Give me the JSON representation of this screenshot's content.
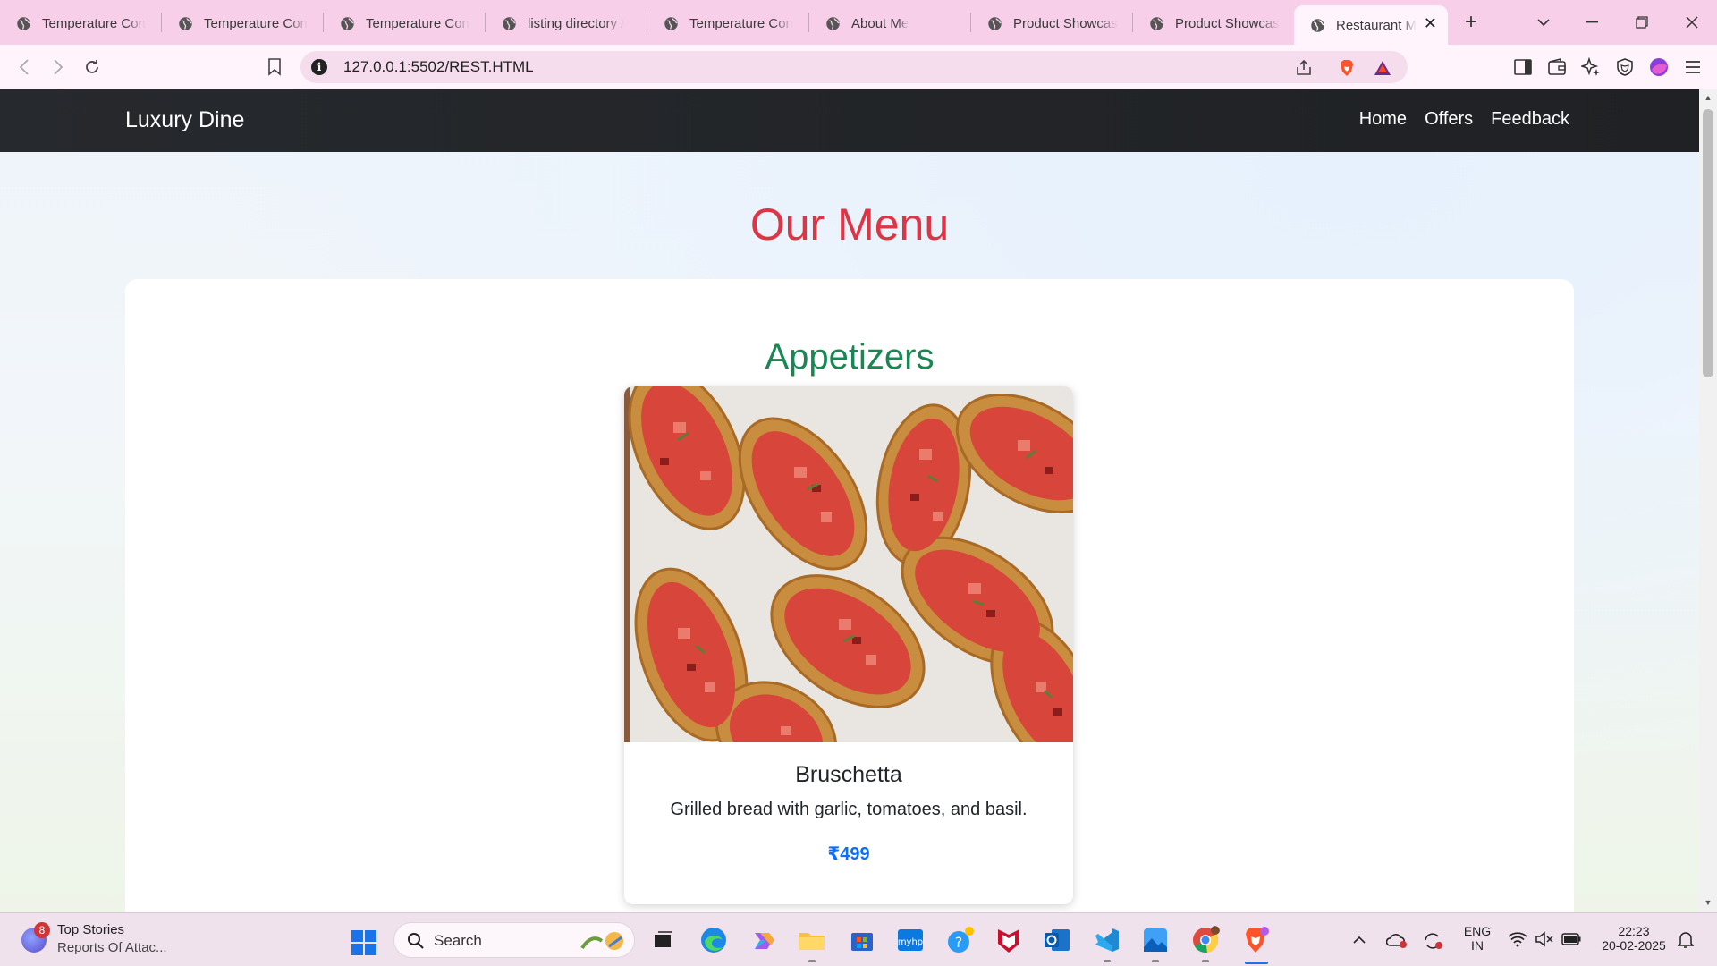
{
  "browser": {
    "tabs": [
      {
        "label": "Temperature Con"
      },
      {
        "label": "Temperature Con"
      },
      {
        "label": "Temperature Con"
      },
      {
        "label": "listing directory /"
      },
      {
        "label": "Temperature Con"
      },
      {
        "label": "About Me"
      },
      {
        "label": "Product Showcas"
      },
      {
        "label": "Product Showcas"
      },
      {
        "label": "Restaurant M"
      }
    ],
    "url": "127.0.0.1:5502/REST.HTML"
  },
  "page": {
    "navbar": {
      "brand": "Luxury Dine",
      "links": [
        "Home",
        "Offers",
        "Feedback"
      ]
    },
    "heading": "Our Menu",
    "section": {
      "title": "Appetizers",
      "items": [
        {
          "name": "Bruschetta",
          "description": "Grilled bread with garlic, tomatoes, and basil.",
          "price": "₹499",
          "image_icon": "bruschetta-photo"
        }
      ]
    },
    "colors": {
      "heading": "#dc3545",
      "section": "#198754",
      "price": "#0d6efd",
      "navbar": "#212529"
    }
  },
  "taskbar": {
    "news_badge": "8",
    "news_title": "Top Stories",
    "news_sub": "Reports Of Attac...",
    "search_label": "Search",
    "lang_top": "ENG",
    "lang_bottom": "IN",
    "time": "22:23",
    "date": "20-02-2025"
  }
}
